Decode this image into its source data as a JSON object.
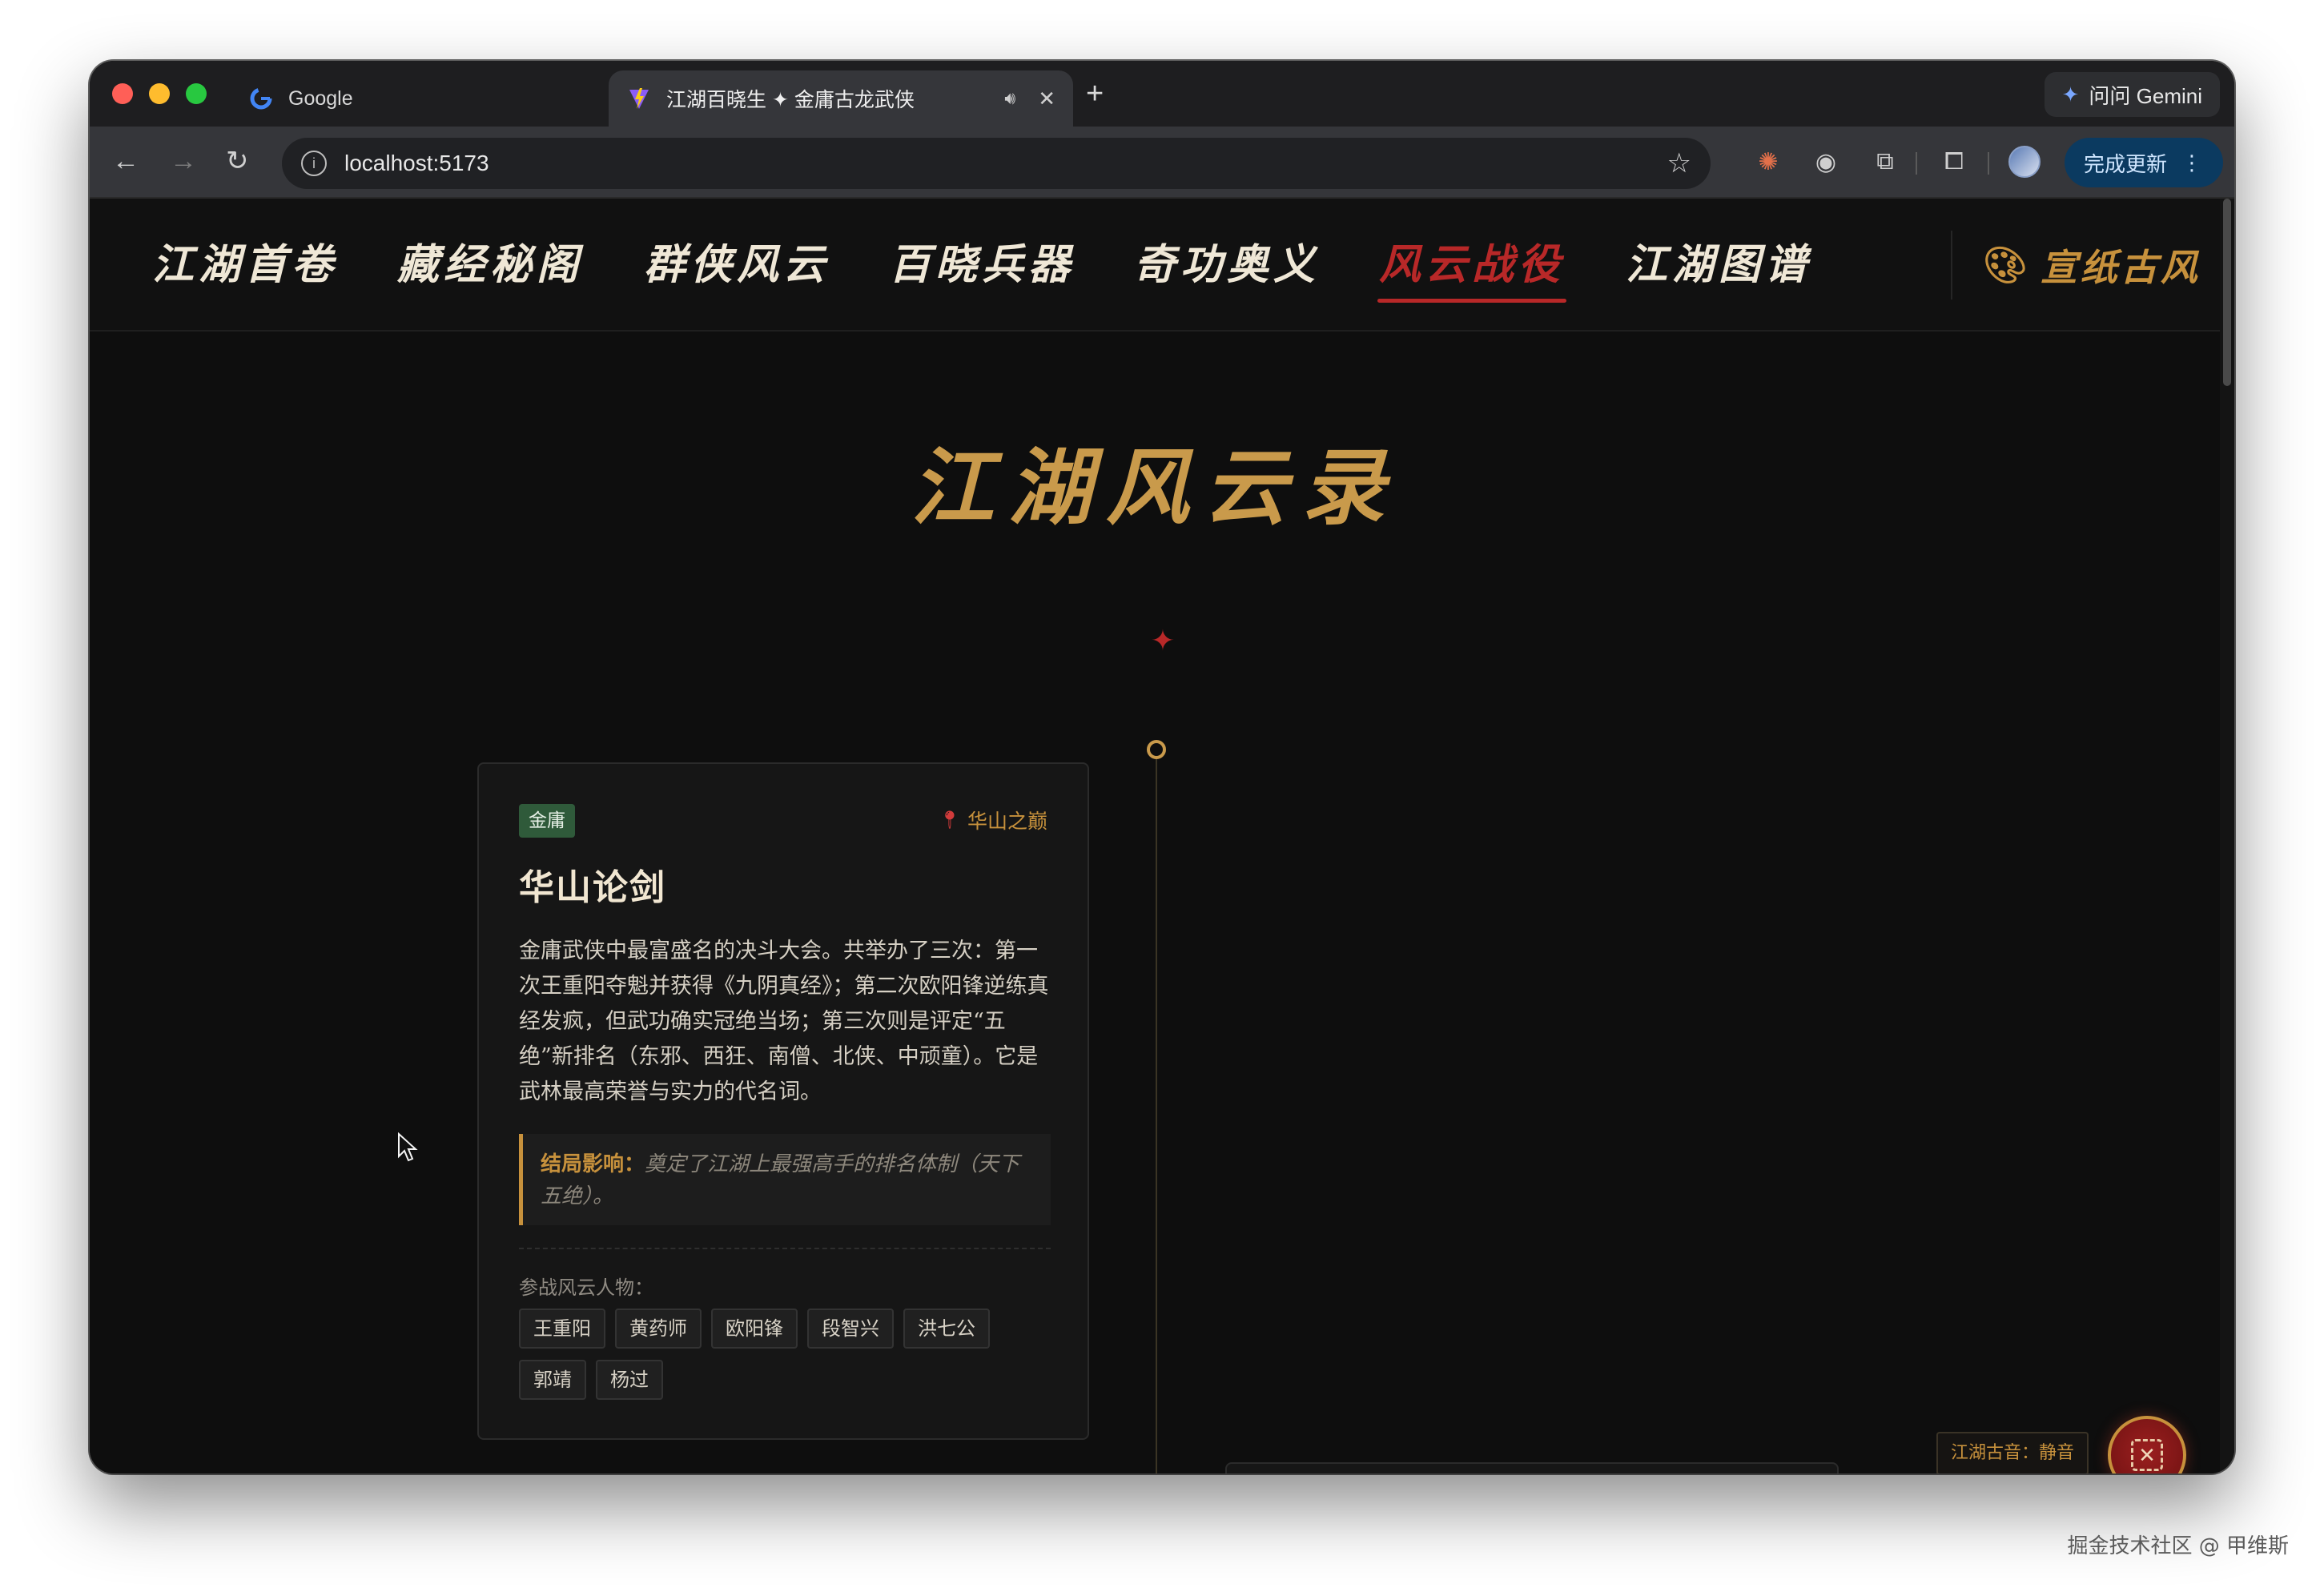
{
  "browser": {
    "tabs": [
      {
        "title": "Google",
        "favicon": "google-icon",
        "active": false
      },
      {
        "title": "江湖百晓生 ✦ 金庸古龙武侠",
        "favicon": "vite-icon",
        "active": true
      }
    ],
    "gemini_label": "问问 Gemini",
    "url": "localhost:5173",
    "update_label": "完成更新"
  },
  "site": {
    "nav": [
      {
        "label": "江湖首卷",
        "active": false
      },
      {
        "label": "藏经秘阁",
        "active": false
      },
      {
        "label": "群侠风云",
        "active": false
      },
      {
        "label": "百晓兵器",
        "active": false
      },
      {
        "label": "奇功奥义",
        "active": false
      },
      {
        "label": "风云战役",
        "active": true
      },
      {
        "label": "江湖图谱",
        "active": false
      }
    ],
    "theme_toggle": "宣纸古风",
    "page_title": "江湖风云录",
    "ornament": "✦"
  },
  "event_card": {
    "author_badge": "金庸",
    "location": "华山之巅",
    "title": "华山论剑",
    "description": "金庸武侠中最富盛名的决斗大会。共举办了三次：第一次王重阳夺魁并获得《九阴真经》；第二次欧阳锋逆练真经发疯，但武功确实冠绝当场；第三次则是评定“五绝”新排名（东邪、西狂、南僧、北侠、中顽童）。它是武林最高荣誉与实力的代名词。",
    "impact_label": "结局影响：",
    "impact_text": "奠定了江湖上最强高手的排名体制（天下五绝）。",
    "participants_label": "参战风云人物：",
    "participants": [
      "王重阳",
      "黄药师",
      "欧阳锋",
      "段智兴",
      "洪七公",
      "郭靖",
      "杨过"
    ]
  },
  "music": {
    "label": "江湖古音：静音",
    "button_icon": "mute-icon"
  },
  "watermark": "掘金技术社区 @ 甲维斯"
}
